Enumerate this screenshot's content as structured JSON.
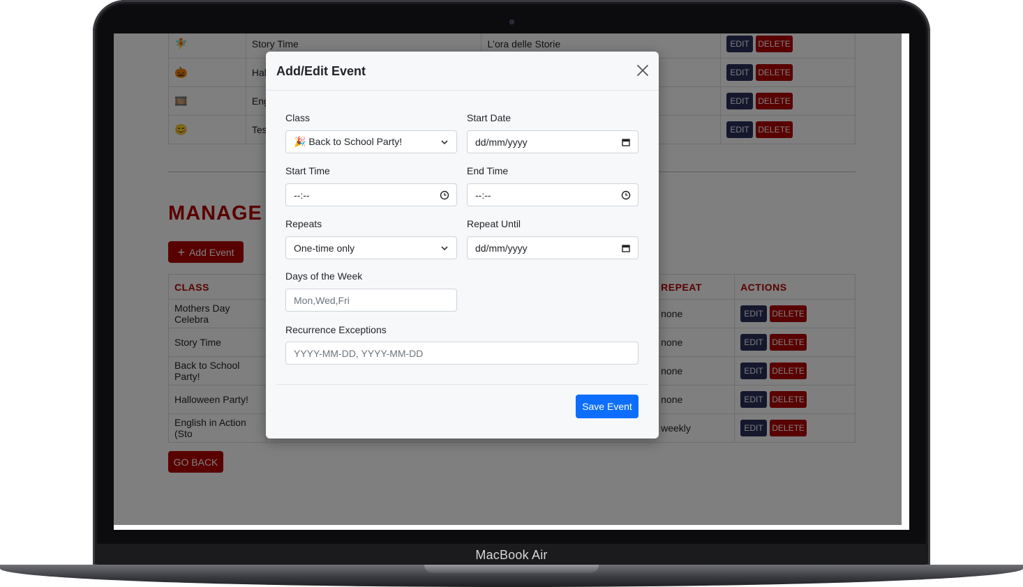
{
  "device": {
    "label": "MacBook Air"
  },
  "top_table": {
    "rows": [
      {
        "emoji": "🧚",
        "name": "Story Time",
        "translation": "L'ora delle Storie"
      },
      {
        "emoji": "🎃",
        "name": "Hal",
        "translation": ""
      },
      {
        "emoji": "🎞️",
        "name": "Eng",
        "translation": ""
      },
      {
        "emoji": "😊",
        "name": "Tes",
        "translation": ""
      }
    ],
    "edit_label": "EDIT",
    "delete_label": "DELETE"
  },
  "manage": {
    "title": "MANAGE",
    "add_event_label": "Add Event",
    "columns": {
      "class": "CLASS",
      "repeat": "REPEAT",
      "actions": "ACTIONS"
    },
    "rows": [
      {
        "class": "Mothers Day Celebra",
        "repeat": "none"
      },
      {
        "class": "Story Time",
        "repeat": "none"
      },
      {
        "class": "Back to School Party!",
        "repeat": "none"
      },
      {
        "class": "Halloween Party!",
        "repeat": "none"
      },
      {
        "class": "English in Action (Sto",
        "repeat": "weekly"
      }
    ],
    "go_back_label": "GO BACK"
  },
  "modal": {
    "title": "Add/Edit Event",
    "class_label": "Class",
    "class_value": "🎉 Back to School Party!",
    "start_date_label": "Start Date",
    "start_date_value": "dd/mm/yyyy",
    "start_time_label": "Start Time",
    "start_time_value": "--:--",
    "end_time_label": "End Time",
    "end_time_value": "--:--",
    "repeats_label": "Repeats",
    "repeats_value": "One-time only",
    "repeat_until_label": "Repeat Until",
    "repeat_until_value": "dd/mm/yyyy",
    "days_label": "Days of the Week",
    "days_placeholder": "Mon,Wed,Fri",
    "exceptions_label": "Recurrence Exceptions",
    "exceptions_placeholder": "YYYY-MM-DD, YYYY-MM-DD",
    "save_label": "Save Event"
  },
  "colors": {
    "accent_red": "#b30000",
    "primary_blue": "#0d6efd",
    "edit_navy": "#2a2f5a"
  }
}
